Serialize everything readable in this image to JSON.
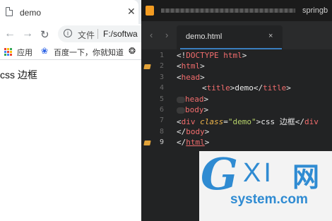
{
  "browser": {
    "tab": {
      "title": "demo",
      "close_icon": "close-icon"
    },
    "toolbar": {
      "back_icon": "arrow-left-icon",
      "forward_icon": "arrow-right-icon",
      "reload_icon": "reload-icon",
      "info_icon": "info-icon",
      "scheme": "文件",
      "url": "F:/softwa"
    },
    "bookmarks": [
      {
        "label": "应用",
        "icon": "apps-grid-icon"
      },
      {
        "label": "百度一下，你就知道",
        "icon": "baidu-paw-icon"
      }
    ],
    "extension_icon": "extension-icon",
    "page_text": "css 边框"
  },
  "editor": {
    "app_icon": "sublime-logo-icon",
    "window_title_visible": "springb",
    "file_tab": {
      "title": "demo.html",
      "close": "×"
    },
    "nav": {
      "prev": "‹",
      "next": "›"
    },
    "line_numbers": [
      "1",
      "2",
      "3",
      "4",
      "5",
      "6",
      "7",
      "8",
      "9"
    ],
    "bookmarked_lines": [
      "2",
      "9"
    ],
    "current_line": "9",
    "code": {
      "l1": {
        "open": "<!",
        "kw": "DOCTYPE html",
        "close": ">"
      },
      "l2": {
        "open": "<",
        "tag": "html",
        "close": ">"
      },
      "l3": {
        "open": "<",
        "tag": "head",
        "close": ">"
      },
      "l4": {
        "open": "<",
        "tag": "title",
        "mid": ">",
        "text": "demo",
        "open2": "</",
        "tag2": "title",
        "close": ">"
      },
      "l5": {
        "tag": "head",
        "close": ">"
      },
      "l6": {
        "tag": "body",
        "close": ">"
      },
      "l7": {
        "open": "<",
        "tag": "div",
        "space": " ",
        "attr": "class",
        "eq": "=",
        "str": "\"demo\"",
        "mid": ">",
        "text": "css 边框",
        "open2": "</",
        "tag2": "div"
      },
      "l8": {
        "open": "</",
        "tag": "body",
        "close": ">"
      },
      "l9": {
        "open": "</",
        "tag": "html",
        "close": ">"
      }
    }
  },
  "watermark": {
    "logo_g": "G",
    "logo_xi": "XI",
    "logo_wang": "网",
    "site": "system.com"
  },
  "colors": {
    "tag": "#f26d6d",
    "attribute": "#f0b64a",
    "string": "#b7d36a",
    "bookmark": "#e2a33a",
    "watermark": "#2f8bd2"
  }
}
